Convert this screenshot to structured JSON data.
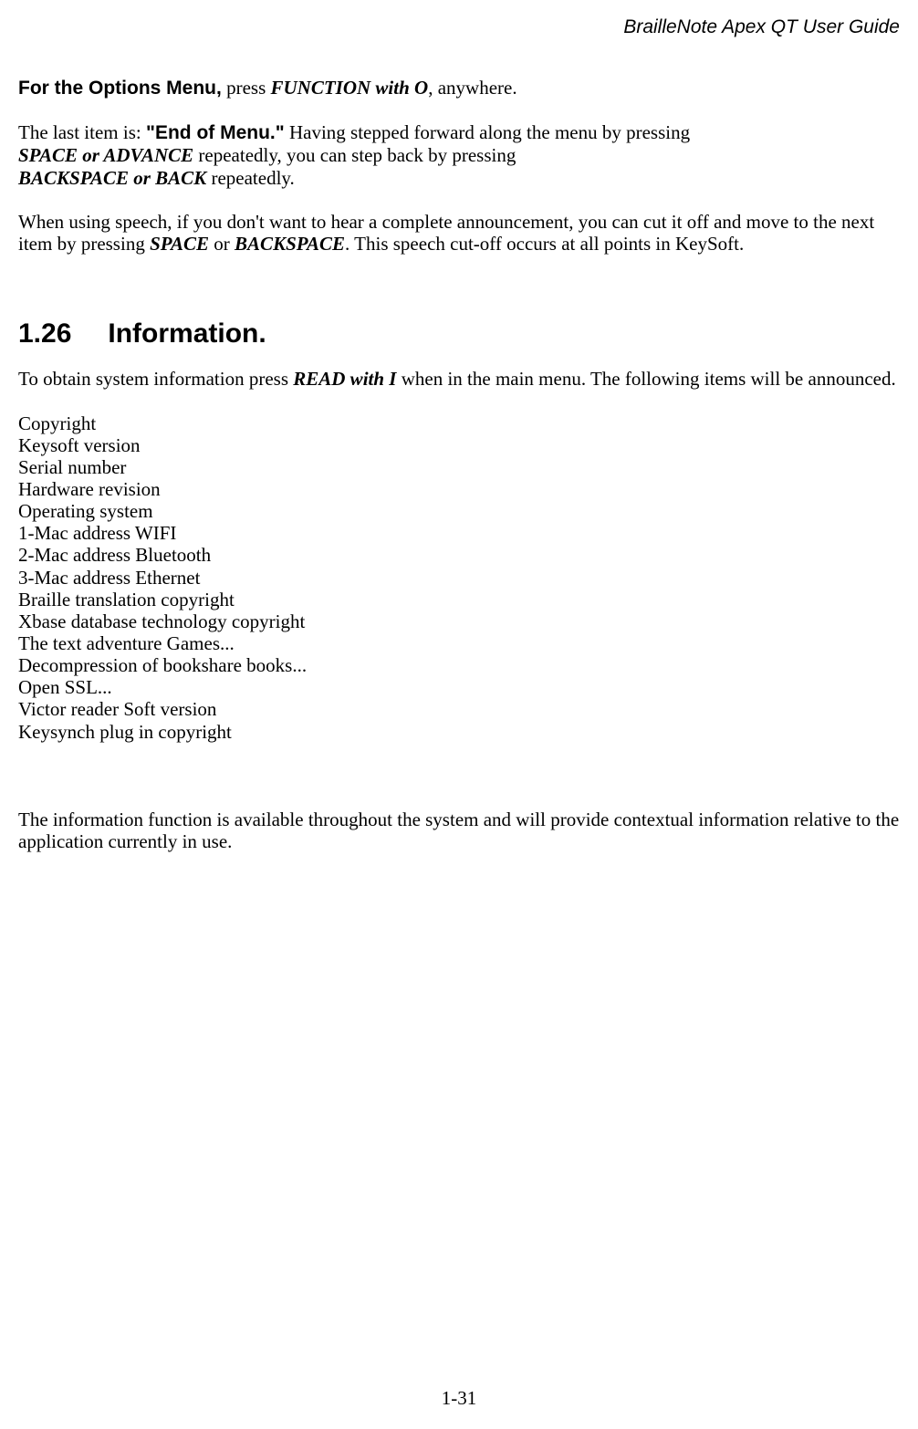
{
  "header": {
    "running_title": "BrailleNote Apex QT User Guide"
  },
  "para1": {
    "options_label": "For the Options Menu,",
    "after_options": " press ",
    "function_o": "FUNCTION with O",
    "after_function": ", anywhere."
  },
  "para2": {
    "lead": "The last item is: ",
    "end_of_menu": "\"End of Menu.\"",
    "after_end": " Having stepped forward along the menu by pressing ",
    "space_advance": "SPACE or ADVANCE",
    "after_space_advance": " repeatedly, you can step back by pressing ",
    "backspace_back": "BACKSPACE or BACK",
    "after_backspace_back": " repeatedly."
  },
  "para3": {
    "before1": "When using speech, if you don't want to hear a complete announcement, you can cut it off and move to the next item by pressing ",
    "space": "SPACE",
    "or": " or ",
    "backspace": "BACKSPACE",
    "after": ". This speech cut-off occurs at all points in KeySoft."
  },
  "section": {
    "number": "1.26",
    "title": "Information."
  },
  "para4": {
    "before": "To obtain system information press ",
    "read_i": "READ with I",
    "after": " when in the main menu. The following items will be announced."
  },
  "info_items": [
    "Copyright",
    "Keysoft version",
    "Serial number",
    "Hardware revision",
    "Operating system",
    "1-Mac address WIFI",
    "2-Mac address Bluetooth",
    "3-Mac address Ethernet",
    "Braille translation copyright",
    "Xbase database technology copyright",
    "The text adventure Games...",
    "Decompression of bookshare books...",
    "Open SSL...",
    "Victor reader Soft version",
    "Keysynch plug in copyright"
  ],
  "para5": "The information function is available throughout the system and will provide contextual information relative to the application currently in use.",
  "footer": {
    "page_number": "1-31"
  }
}
